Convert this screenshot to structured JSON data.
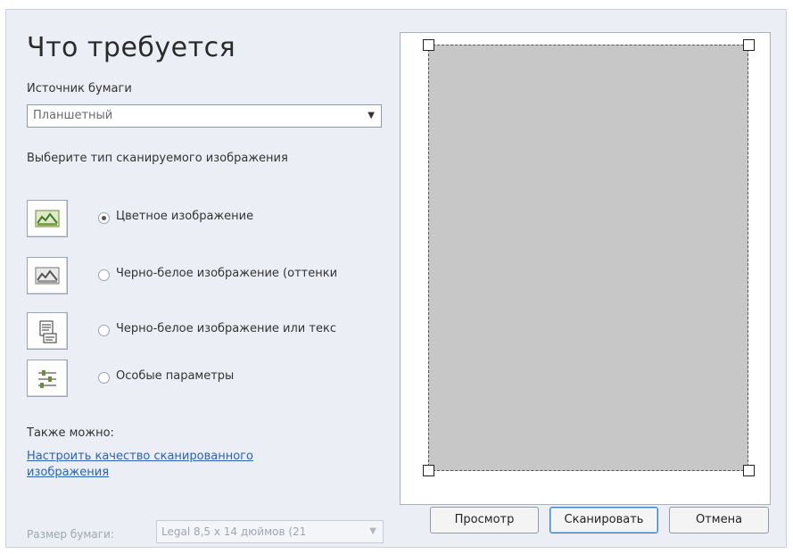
{
  "header": {
    "title": "Что требуется"
  },
  "source": {
    "label": "Источник бумаги",
    "value": "Планшетный"
  },
  "hint": "Выберите тип сканируемого изображения",
  "options": [
    {
      "label": "Цветное изображение",
      "icon": "color-picture-icon",
      "selected": true
    },
    {
      "label": "Черно-белое изображение (оттенки",
      "icon": "grayscale-picture-icon",
      "selected": false
    },
    {
      "label": "Черно-белое изображение или текс",
      "icon": "text-document-icon",
      "selected": false
    },
    {
      "label": "Особые параметры",
      "icon": "custom-settings-icon",
      "selected": false
    }
  ],
  "also": {
    "label": "Также можно:",
    "link": "Настроить качество сканированного изображения"
  },
  "paper_size": {
    "label": "Размер бумаги:",
    "value": "Legal 8,5 x 14 дюймов (21"
  },
  "buttons": {
    "preview": "Просмотр",
    "scan": "Сканировать",
    "cancel": "Отмена"
  },
  "colors": {
    "preview_area": "#c7c7c7",
    "link": "#2a63b5",
    "accent_border": "#3c7fc1"
  }
}
